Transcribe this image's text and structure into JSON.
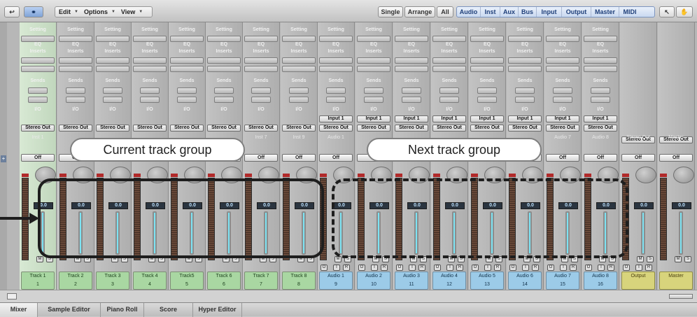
{
  "toolbar": {
    "menus": [
      {
        "label": "Edit"
      },
      {
        "label": "Options"
      },
      {
        "label": "View"
      }
    ],
    "view_modes": [
      {
        "label": "Single"
      },
      {
        "label": "Arrange"
      },
      {
        "label": "All"
      }
    ],
    "filters": [
      {
        "label": "Audio"
      },
      {
        "label": "Inst"
      },
      {
        "label": "Aux"
      },
      {
        "label": "Bus"
      },
      {
        "label": "Input"
      },
      {
        "label": "Output"
      },
      {
        "label": "Master"
      },
      {
        "label": "MIDI"
      }
    ]
  },
  "strip_labels": {
    "setting": "Setting",
    "eq": "EQ",
    "inserts": "Inserts",
    "sends": "Sends",
    "io": "I/O",
    "input": "Input 1",
    "output": "Stereo Out",
    "off": "Off"
  },
  "strips": [
    {
      "name": "Track 1",
      "number": "1",
      "sub": "Inst 1",
      "kind": "inst",
      "selected": true,
      "value": "0.0"
    },
    {
      "name": "Track 2",
      "number": "2",
      "sub": "",
      "kind": "inst",
      "value": "0.0"
    },
    {
      "name": "Track 3",
      "number": "3",
      "sub": "",
      "kind": "inst",
      "value": "0.0"
    },
    {
      "name": "Track 4",
      "number": "4",
      "sub": "",
      "kind": "inst",
      "value": "0.0"
    },
    {
      "name": "Track5",
      "number": "5",
      "sub": "",
      "kind": "inst",
      "value": "0.0"
    },
    {
      "name": "Track 6",
      "number": "6",
      "sub": "",
      "kind": "inst",
      "value": "0.0"
    },
    {
      "name": "Track 7",
      "number": "7",
      "sub": "Inst 7",
      "kind": "inst",
      "value": "0.0"
    },
    {
      "name": "Track 8",
      "number": "8",
      "sub": "Inst 9",
      "kind": "inst",
      "value": "0.0"
    },
    {
      "name": "Audio 1",
      "number": "9",
      "sub": "Audio 1",
      "kind": "audio",
      "value": "0.0"
    },
    {
      "name": "Audio 2",
      "number": "10",
      "sub": "",
      "kind": "audio",
      "value": "0.0"
    },
    {
      "name": "Audio 3",
      "number": "11",
      "sub": "",
      "kind": "audio",
      "value": "0.0"
    },
    {
      "name": "Audio 4",
      "number": "12",
      "sub": "",
      "kind": "audio",
      "value": "0.0"
    },
    {
      "name": "Audio 5",
      "number": "13",
      "sub": "",
      "kind": "audio",
      "value": "0.0"
    },
    {
      "name": "Audio 6",
      "number": "14",
      "sub": "",
      "kind": "audio",
      "value": "0.0"
    },
    {
      "name": "Audio 7",
      "number": "15",
      "sub": "Audio 7",
      "kind": "audio",
      "value": "0.0"
    },
    {
      "name": "Audio 8",
      "number": "16",
      "sub": "Audio 8",
      "kind": "audio",
      "value": "0.0"
    },
    {
      "name": "Output",
      "number": "",
      "sub": "Stereo Out",
      "kind": "output",
      "value": "0.0"
    },
    {
      "name": "Master",
      "number": "",
      "sub": "Master",
      "kind": "master",
      "value": "0.0"
    }
  ],
  "callouts": {
    "current": "Current track group",
    "next": "Next track group"
  },
  "bottom_tabs": [
    {
      "label": "Mixer"
    },
    {
      "label": "Sample Editor"
    },
    {
      "label": "Piano Roll"
    },
    {
      "label": "Score"
    },
    {
      "label": "Hyper Editor"
    }
  ],
  "colors": {
    "inst": "#a9d7a2",
    "audio": "#9ccbe8",
    "output": "#d8d47c",
    "fader": "#7ce3f3"
  }
}
